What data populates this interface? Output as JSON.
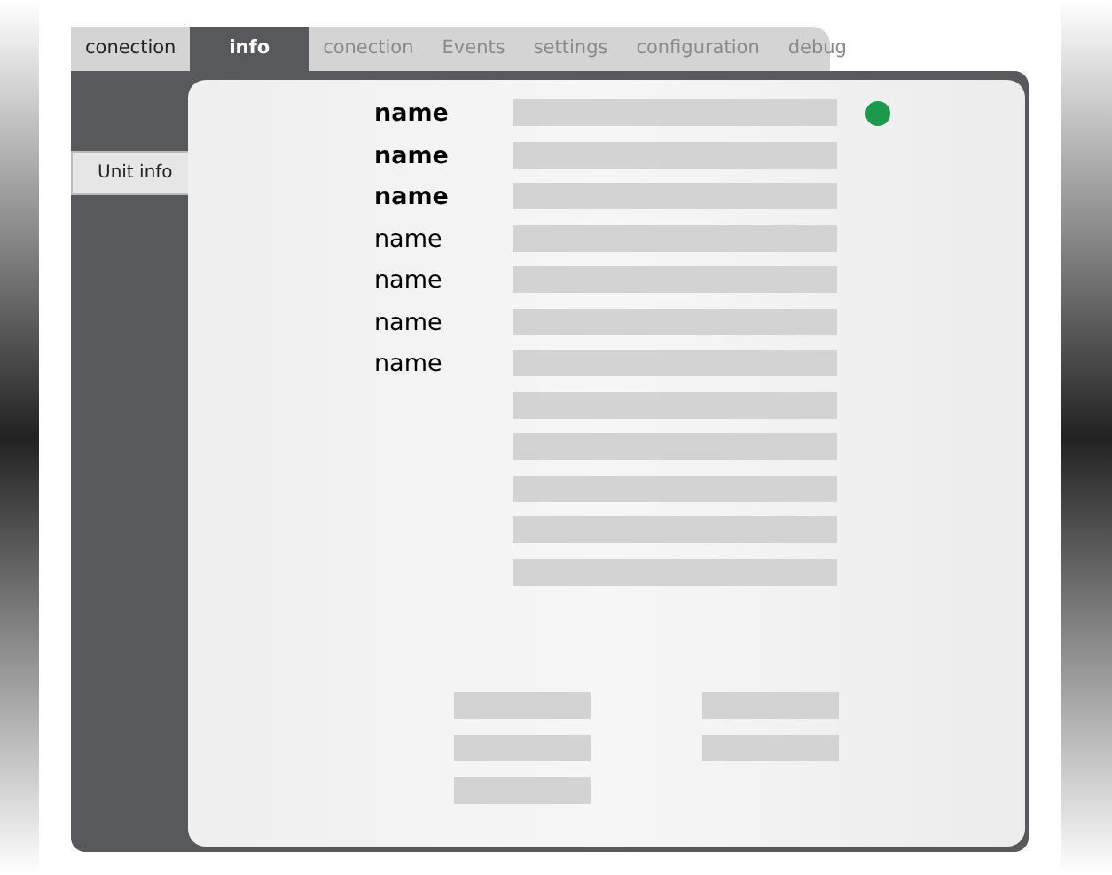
{
  "tabs": [
    {
      "label": "conection",
      "selected": false,
      "disabled": false
    },
    {
      "label": "info",
      "selected": true,
      "disabled": false
    },
    {
      "label": "conection",
      "selected": false,
      "disabled": true
    },
    {
      "label": "Events",
      "selected": false,
      "disabled": true
    },
    {
      "label": "settings",
      "selected": false,
      "disabled": true
    },
    {
      "label": "configuration",
      "selected": false,
      "disabled": true
    },
    {
      "label": "debug",
      "selected": false,
      "disabled": true
    }
  ],
  "sidebar": {
    "items": [
      {
        "label": "Unit info",
        "selected": true
      }
    ]
  },
  "status": {
    "color": "#1a9a4a"
  },
  "fields": [
    {
      "kind": "labeled",
      "label": "name",
      "bold": true
    },
    {
      "kind": "labeled",
      "label": "name",
      "bold": true
    },
    {
      "kind": "labeled",
      "label": "name",
      "bold": true
    },
    {
      "kind": "labeled",
      "label": "name",
      "bold": false
    },
    {
      "kind": "labeled",
      "label": "name",
      "bold": false
    },
    {
      "kind": "labeled",
      "label": "name",
      "bold": false
    },
    {
      "kind": "labeled",
      "label": "name",
      "bold": false
    },
    {
      "kind": "unlabeled"
    },
    {
      "kind": "unlabeled"
    },
    {
      "kind": "unlabeled"
    },
    {
      "kind": "unlabeled"
    },
    {
      "kind": "unlabeled"
    }
  ],
  "bottom_fields": {
    "left": [
      {
        "kind": "unlabeled"
      },
      {
        "kind": "unlabeled"
      },
      {
        "kind": "unlabeled"
      }
    ],
    "right": [
      {
        "kind": "unlabeled"
      },
      {
        "kind": "unlabeled"
      }
    ]
  }
}
